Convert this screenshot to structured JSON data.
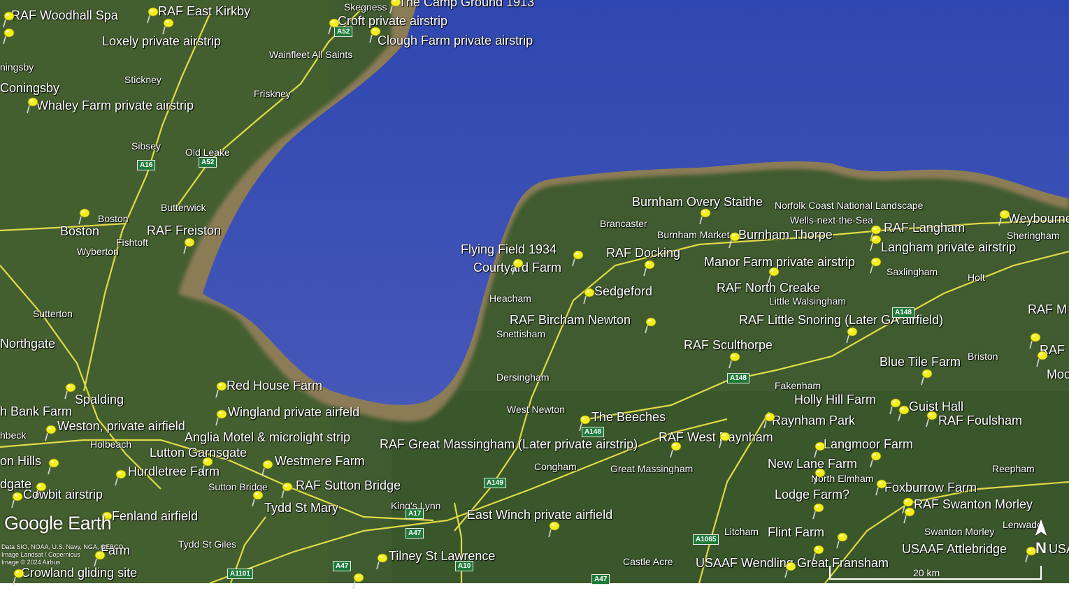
{
  "brand": "Google Earth",
  "credits": [
    "Data SIO, NOAA, U.S. Navy, NGA, GEBCO",
    "Image Landsat / Copernicus",
    "Image © 2024 Airbus"
  ],
  "scale": {
    "label": "20 km"
  },
  "compass": {
    "label": "N"
  },
  "colors": {
    "sea": "#3a4fb3",
    "land": "#3d5a2e",
    "mudflat": "#8a7a55",
    "road": "#f2e84a",
    "pin": "#f3ee1c"
  },
  "places": [
    {
      "id": "p01",
      "name": "RAF Woodhall Spa",
      "kind": "pin"
    },
    {
      "id": "p02",
      "name": "RAF East Kirkby",
      "kind": "pin"
    },
    {
      "id": "p03",
      "name": "Skegness",
      "kind": "town"
    },
    {
      "id": "p04",
      "name": "The Camp Ground 1913",
      "kind": "pin"
    },
    {
      "id": "p05",
      "name": "Croft private airstrip",
      "kind": "pin"
    },
    {
      "id": "p06",
      "name": "Loxely private airstrip",
      "kind": "pin"
    },
    {
      "id": "p07",
      "name": "Clough Farm private airstrip",
      "kind": "pin"
    },
    {
      "id": "p08",
      "name": "Wainfleet All Saints",
      "kind": "town"
    },
    {
      "id": "p09",
      "name": "ningsby",
      "kind": "town"
    },
    {
      "id": "p10",
      "name": "Stickney",
      "kind": "town"
    },
    {
      "id": "p11",
      "name": "Coningsby",
      "kind": "pin"
    },
    {
      "id": "p12",
      "name": "Friskney",
      "kind": "town"
    },
    {
      "id": "p13",
      "name": "Whaley Farm private airstrip",
      "kind": "pin"
    },
    {
      "id": "p14",
      "name": "Sibsey",
      "kind": "town"
    },
    {
      "id": "p15",
      "name": "Old Leake",
      "kind": "town"
    },
    {
      "id": "p16",
      "name": "Butterwick",
      "kind": "town"
    },
    {
      "id": "p17",
      "name": "Boston",
      "kind": "town"
    },
    {
      "id": "p18",
      "name": "Boston",
      "kind": "pin"
    },
    {
      "id": "p19",
      "name": "RAF Freiston",
      "kind": "pin"
    },
    {
      "id": "p20",
      "name": "Fishtoft",
      "kind": "town"
    },
    {
      "id": "p21",
      "name": "Wyberton",
      "kind": "town"
    },
    {
      "id": "p22",
      "name": "Sutterton",
      "kind": "town"
    },
    {
      "id": "p23",
      "name": "Northgate",
      "kind": "pin"
    },
    {
      "id": "p24",
      "name": "Burnham Overy Staithe",
      "kind": "pin"
    },
    {
      "id": "p25",
      "name": "Norfolk Coast National Landscape",
      "kind": "town"
    },
    {
      "id": "p26",
      "name": "Weybourne",
      "kind": "pin"
    },
    {
      "id": "p27",
      "name": "Brancaster",
      "kind": "town"
    },
    {
      "id": "p28",
      "name": "Wells-next-the-Sea",
      "kind": "town"
    },
    {
      "id": "p29",
      "name": "RAF Langham",
      "kind": "pin"
    },
    {
      "id": "p30",
      "name": "Sheringham",
      "kind": "town"
    },
    {
      "id": "p31",
      "name": "Burnham Market",
      "kind": "town"
    },
    {
      "id": "p32",
      "name": "Burnham Thorpe",
      "kind": "pin"
    },
    {
      "id": "p33",
      "name": "Langham private airstrip",
      "kind": "pin"
    },
    {
      "id": "p34",
      "name": "Flying Field 1934",
      "kind": "pin"
    },
    {
      "id": "p35",
      "name": "RAF Docking",
      "kind": "pin"
    },
    {
      "id": "p36",
      "name": "Courtyard Farm",
      "kind": "pin"
    },
    {
      "id": "p37",
      "name": "Manor Farm private airstrip",
      "kind": "pin"
    },
    {
      "id": "p38",
      "name": "Saxlingham",
      "kind": "town"
    },
    {
      "id": "p39",
      "name": "Holt",
      "kind": "town"
    },
    {
      "id": "p40",
      "name": "RAF North Creake",
      "kind": "pin"
    },
    {
      "id": "p41",
      "name": "Sedgeford",
      "kind": "pin"
    },
    {
      "id": "p42",
      "name": "Heacham",
      "kind": "town"
    },
    {
      "id": "p43",
      "name": "Little Walsingham",
      "kind": "town"
    },
    {
      "id": "p44",
      "name": "RAF M",
      "kind": "pin"
    },
    {
      "id": "p45",
      "name": "RAF Bircham Newton",
      "kind": "pin"
    },
    {
      "id": "p46",
      "name": "RAF Little Snoring (Later GA airfield)",
      "kind": "pin"
    },
    {
      "id": "p47",
      "name": "Snettisham",
      "kind": "town"
    },
    {
      "id": "p48",
      "name": "RAF Sculthorpe",
      "kind": "pin"
    },
    {
      "id": "p49",
      "name": "RAF",
      "kind": "pin"
    },
    {
      "id": "p50",
      "name": "Briston",
      "kind": "town"
    },
    {
      "id": "p51",
      "name": "Blue Tile Farm",
      "kind": "pin"
    },
    {
      "id": "p52",
      "name": "Moo",
      "kind": "pin"
    },
    {
      "id": "p53",
      "name": "Dersingham",
      "kind": "town"
    },
    {
      "id": "p54",
      "name": "Fakenham",
      "kind": "town"
    },
    {
      "id": "p55",
      "name": "Red House Farm",
      "kind": "pin"
    },
    {
      "id": "p56",
      "name": "Spalding",
      "kind": "pin"
    },
    {
      "id": "p57",
      "name": "Holly Hill Farm",
      "kind": "pin"
    },
    {
      "id": "p58",
      "name": "Guist Hall",
      "kind": "pin"
    },
    {
      "id": "p59",
      "name": "h Bank Farm",
      "kind": "pin"
    },
    {
      "id": "p60",
      "name": "Wingland private airfeld",
      "kind": "pin"
    },
    {
      "id": "p61",
      "name": "West Newton",
      "kind": "town"
    },
    {
      "id": "p62",
      "name": "The Beeches",
      "kind": "pin"
    },
    {
      "id": "p63",
      "name": "Raynham Park",
      "kind": "pin"
    },
    {
      "id": "p64",
      "name": "RAF Foulsham",
      "kind": "pin"
    },
    {
      "id": "p65",
      "name": "Weston, private airfield",
      "kind": "pin"
    },
    {
      "id": "p66",
      "name": "hbeck",
      "kind": "town"
    },
    {
      "id": "p67",
      "name": "Anglia Motel & microlight strip",
      "kind": "pin"
    },
    {
      "id": "p68",
      "name": "RAF West Raynham",
      "kind": "pin"
    },
    {
      "id": "p69",
      "name": "Holbeach",
      "kind": "town"
    },
    {
      "id": "p70",
      "name": "RAF Great Massingham (Later private airstrip)",
      "kind": "pin"
    },
    {
      "id": "p71",
      "name": "Langmoor Farm",
      "kind": "pin"
    },
    {
      "id": "p72",
      "name": "Lutton Garnsgate",
      "kind": "pin"
    },
    {
      "id": "p73",
      "name": "on Hills",
      "kind": "pin"
    },
    {
      "id": "p74",
      "name": "Westmere Farm",
      "kind": "pin"
    },
    {
      "id": "p75",
      "name": "New Lane Farm",
      "kind": "pin"
    },
    {
      "id": "p76",
      "name": "Congham",
      "kind": "town"
    },
    {
      "id": "p77",
      "name": "Great Massingham",
      "kind": "town"
    },
    {
      "id": "p78",
      "name": "Reepham",
      "kind": "town"
    },
    {
      "id": "p79",
      "name": "Hurdletree Farm",
      "kind": "pin"
    },
    {
      "id": "p80",
      "name": "North Elmham",
      "kind": "town"
    },
    {
      "id": "p81",
      "name": "dgate",
      "kind": "pin"
    },
    {
      "id": "p82",
      "name": "Sutton Bridge",
      "kind": "town"
    },
    {
      "id": "p83",
      "name": "RAF Sutton Bridge",
      "kind": "pin"
    },
    {
      "id": "p84",
      "name": "Foxburrow Farm",
      "kind": "pin"
    },
    {
      "id": "p85",
      "name": "Cowbit airstrip",
      "kind": "pin"
    },
    {
      "id": "p86",
      "name": "Lodge Farm?",
      "kind": "pin"
    },
    {
      "id": "p87",
      "name": "Tydd St Mary",
      "kind": "pin"
    },
    {
      "id": "p88",
      "name": "King's Lynn",
      "kind": "town"
    },
    {
      "id": "p89",
      "name": "RAF Swanton Morley",
      "kind": "pin"
    },
    {
      "id": "p90",
      "name": "Fenland airfield",
      "kind": "pin"
    },
    {
      "id": "p91",
      "name": "East Winch private airfield",
      "kind": "pin"
    },
    {
      "id": "p92",
      "name": "Lenwade",
      "kind": "town"
    },
    {
      "id": "p93",
      "name": "Litcham",
      "kind": "town"
    },
    {
      "id": "p94",
      "name": "Flint Farm",
      "kind": "pin"
    },
    {
      "id": "p95",
      "name": "Swanton Morley",
      "kind": "town"
    },
    {
      "id": "p96",
      "name": "Tydd St Giles",
      "kind": "town"
    },
    {
      "id": "p97",
      "name": "Farm",
      "kind": "pin"
    },
    {
      "id": "p98",
      "name": "USAAF Attlebridge",
      "kind": "pin"
    },
    {
      "id": "p99",
      "name": "Tilney St Lawrence",
      "kind": "pin"
    },
    {
      "id": "p100",
      "name": "Castle Acre",
      "kind": "town"
    },
    {
      "id": "p101",
      "name": "USAAF Wendling",
      "kind": "pin"
    },
    {
      "id": "p102",
      "name": "Great Fransham",
      "kind": "pin"
    },
    {
      "id": "p103",
      "name": "Crowland gliding site",
      "kind": "pin"
    },
    {
      "id": "p104",
      "name": "USAA",
      "kind": "pin"
    }
  ],
  "roads": [
    {
      "id": "r1",
      "ref": "A52"
    },
    {
      "id": "r2",
      "ref": "A16"
    },
    {
      "id": "r3",
      "ref": "A52"
    },
    {
      "id": "r4",
      "ref": "A148"
    },
    {
      "id": "r5",
      "ref": "A148"
    },
    {
      "id": "r6",
      "ref": "A148"
    },
    {
      "id": "r7",
      "ref": "A149"
    },
    {
      "id": "r8",
      "ref": "A17"
    },
    {
      "id": "r9",
      "ref": "A47"
    },
    {
      "id": "r10",
      "ref": "A1065"
    },
    {
      "id": "r11",
      "ref": "A47"
    },
    {
      "id": "r12",
      "ref": "A10"
    },
    {
      "id": "r13",
      "ref": "A1101"
    },
    {
      "id": "r14",
      "ref": "A47"
    }
  ]
}
